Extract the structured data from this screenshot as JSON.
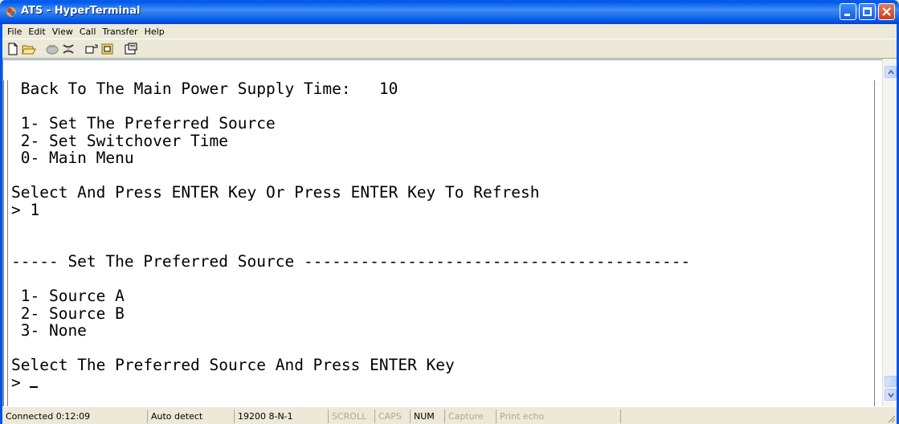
{
  "window": {
    "title": "ATS - HyperTerminal",
    "icon": "hyperterminal-icon"
  },
  "menu": [
    "File",
    "Edit",
    "View",
    "Call",
    "Transfer",
    "Help"
  ],
  "toolbar": {
    "buttons": [
      "new-icon",
      "open-icon",
      "call-icon",
      "disconnect-icon",
      "send-icon",
      "receive-icon",
      "properties-icon"
    ]
  },
  "terminal": {
    "lines": [
      " Back To The Main Power Supply Time:   10",
      "",
      " 1- Set The Preferred Source",
      " 2- Set Switchover Time",
      " 0- Main Menu",
      "",
      "Select And Press ENTER Key Or Press ENTER Key To Refresh",
      "> 1",
      "",
      "",
      "----- Set The Preferred Source -----------------------------------------",
      "",
      " 1- Source A",
      " 2- Source B",
      " 3- None",
      "",
      "Select The Preferred Source And Press ENTER Key"
    ],
    "prompt": "> "
  },
  "statusbar": {
    "connected": "Connected 0:12:09",
    "detect": "Auto detect",
    "port": "19200 8-N-1",
    "scroll": "SCROLL",
    "caps": "CAPS",
    "num": "NUM",
    "capture": "Capture",
    "print_echo": "Print echo"
  },
  "colors": {
    "titlebar": "#0055e5",
    "close_button": "#c4411b",
    "chrome": "#ece9d8"
  }
}
